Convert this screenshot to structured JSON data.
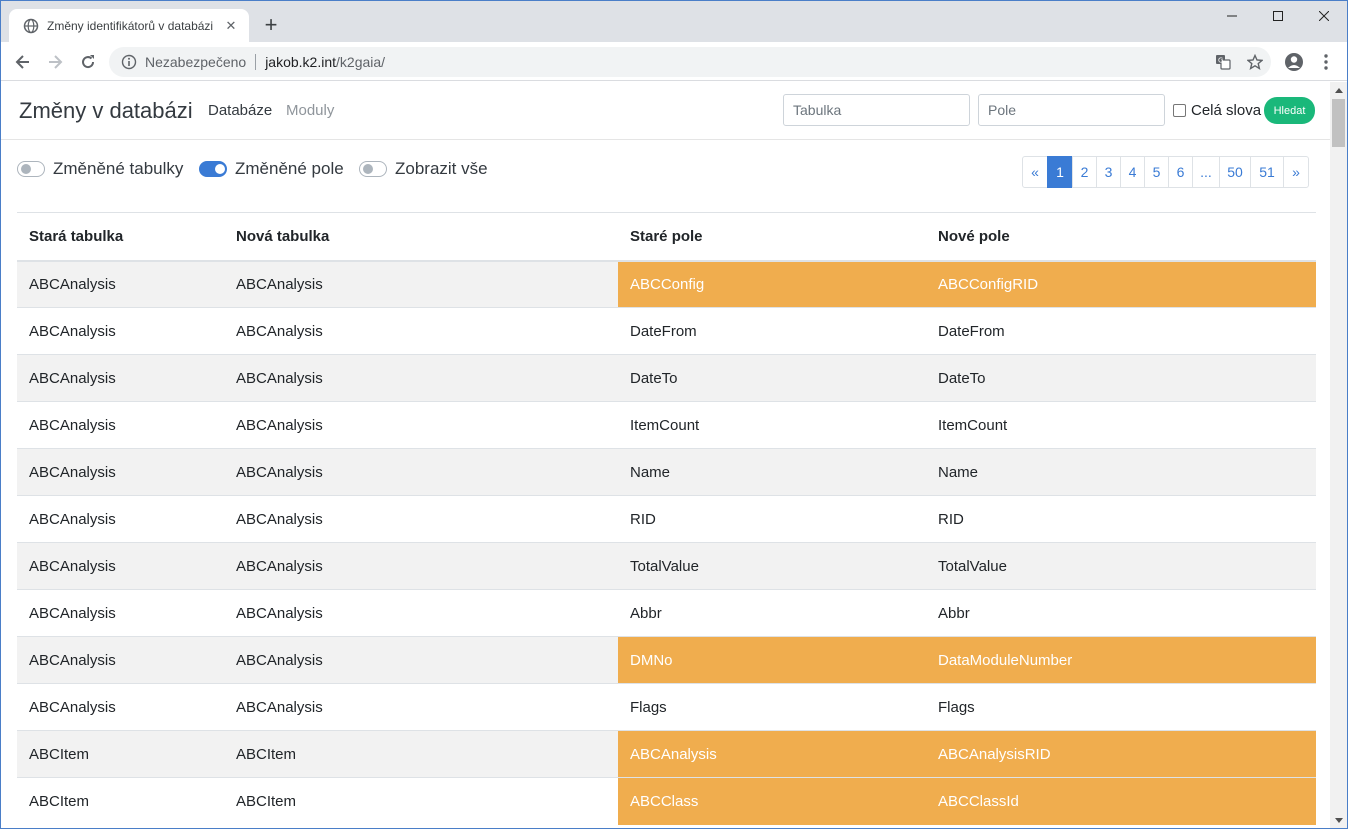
{
  "browser": {
    "tab_title": "Změny identifikátorů v databázi",
    "new_tab_label": "+",
    "not_secure_label": "Nezabezpečeno",
    "url_host": "jakob.k2.int",
    "url_path": "/k2gaia/"
  },
  "navbar": {
    "brand": "Změny v databázi",
    "links": [
      "Databáze",
      "Moduly"
    ],
    "table_placeholder": "Tabulka",
    "field_placeholder": "Pole",
    "whole_words_label": "Celá slova",
    "search_button": "Hledat"
  },
  "toggles": [
    {
      "label": "Změněné tabulky",
      "on": false
    },
    {
      "label": "Změněné pole",
      "on": true
    },
    {
      "label": "Zobrazit vše",
      "on": false
    }
  ],
  "pagination": {
    "items": [
      "«",
      "1",
      "2",
      "3",
      "4",
      "5",
      "6",
      "...",
      "50",
      "51",
      "»"
    ],
    "active": "1"
  },
  "table": {
    "headers": [
      "Stará tabulka",
      "Nová tabulka",
      "Staré pole",
      "Nové pole"
    ],
    "rows": [
      {
        "old_table": "ABCAnalysis",
        "new_table": "ABCAnalysis",
        "old_field": "ABCConfig",
        "new_field": "ABCConfigRID",
        "changed": true
      },
      {
        "old_table": "ABCAnalysis",
        "new_table": "ABCAnalysis",
        "old_field": "DateFrom",
        "new_field": "DateFrom",
        "changed": false
      },
      {
        "old_table": "ABCAnalysis",
        "new_table": "ABCAnalysis",
        "old_field": "DateTo",
        "new_field": "DateTo",
        "changed": false
      },
      {
        "old_table": "ABCAnalysis",
        "new_table": "ABCAnalysis",
        "old_field": "ItemCount",
        "new_field": "ItemCount",
        "changed": false
      },
      {
        "old_table": "ABCAnalysis",
        "new_table": "ABCAnalysis",
        "old_field": "Name",
        "new_field": "Name",
        "changed": false
      },
      {
        "old_table": "ABCAnalysis",
        "new_table": "ABCAnalysis",
        "old_field": "RID",
        "new_field": "RID",
        "changed": false
      },
      {
        "old_table": "ABCAnalysis",
        "new_table": "ABCAnalysis",
        "old_field": "TotalValue",
        "new_field": "TotalValue",
        "changed": false
      },
      {
        "old_table": "ABCAnalysis",
        "new_table": "ABCAnalysis",
        "old_field": "Abbr",
        "new_field": "Abbr",
        "changed": false
      },
      {
        "old_table": "ABCAnalysis",
        "new_table": "ABCAnalysis",
        "old_field": "DMNo",
        "new_field": "DataModuleNumber",
        "changed": true
      },
      {
        "old_table": "ABCAnalysis",
        "new_table": "ABCAnalysis",
        "old_field": "Flags",
        "new_field": "Flags",
        "changed": false
      },
      {
        "old_table": "ABCItem",
        "new_table": "ABCItem",
        "old_field": "ABCAnalysis",
        "new_field": "ABCAnalysisRID",
        "changed": true
      },
      {
        "old_table": "ABCItem",
        "new_table": "ABCItem",
        "old_field": "ABCClass",
        "new_field": "ABCClassId",
        "changed": true
      }
    ]
  },
  "colors": {
    "accent": "#3a7bd5",
    "changed": "#f0ad4e",
    "search_button": "#1ab87a",
    "stripe": "#f2f2f2"
  }
}
